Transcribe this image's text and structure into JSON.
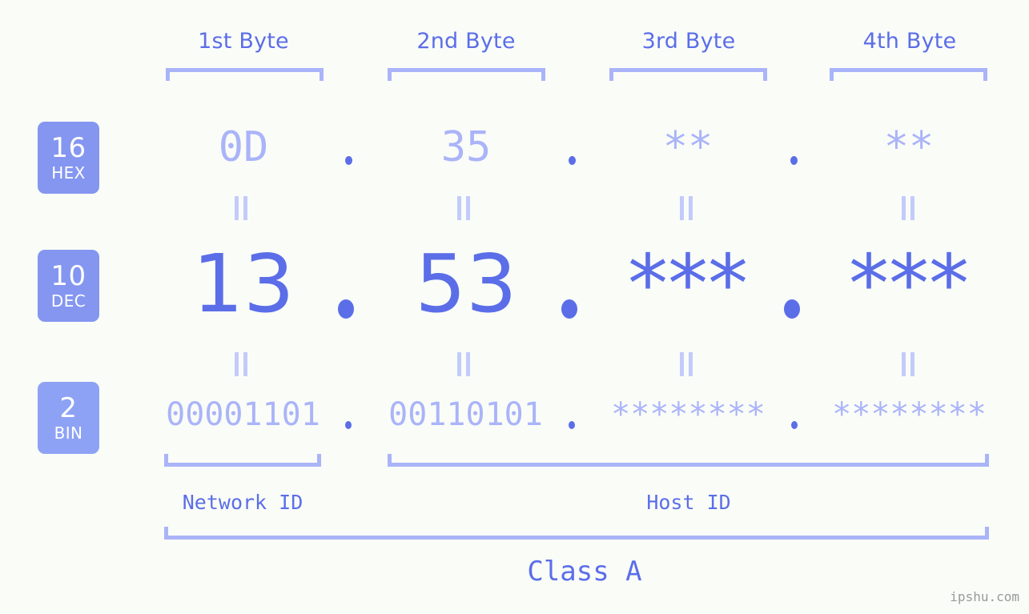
{
  "background_color": "#fafcf8",
  "accent_light": "#aab4f8",
  "accent_strong": "#5b6ee8",
  "badge_color": "#8496f0",
  "byte_headers": [
    {
      "label": "1st Byte"
    },
    {
      "label": "2nd Byte"
    },
    {
      "label": "3rd Byte"
    },
    {
      "label": "4th Byte"
    }
  ],
  "rows": [
    {
      "base": "16",
      "base_name": "HEX",
      "values": [
        "0D",
        "35",
        "**",
        "**"
      ],
      "separator": "."
    },
    {
      "base": "10",
      "base_name": "DEC",
      "values": [
        "13",
        "53",
        "***",
        "***"
      ],
      "separator": "."
    },
    {
      "base": "2",
      "base_name": "BIN",
      "values": [
        "00001101",
        "00110101",
        "********",
        "********"
      ],
      "separator": "."
    }
  ],
  "equals_symbol": "=",
  "sections": [
    {
      "label": "Network ID"
    },
    {
      "label": "Host ID"
    }
  ],
  "class_label": "Class A",
  "watermark": "ipshu.com"
}
